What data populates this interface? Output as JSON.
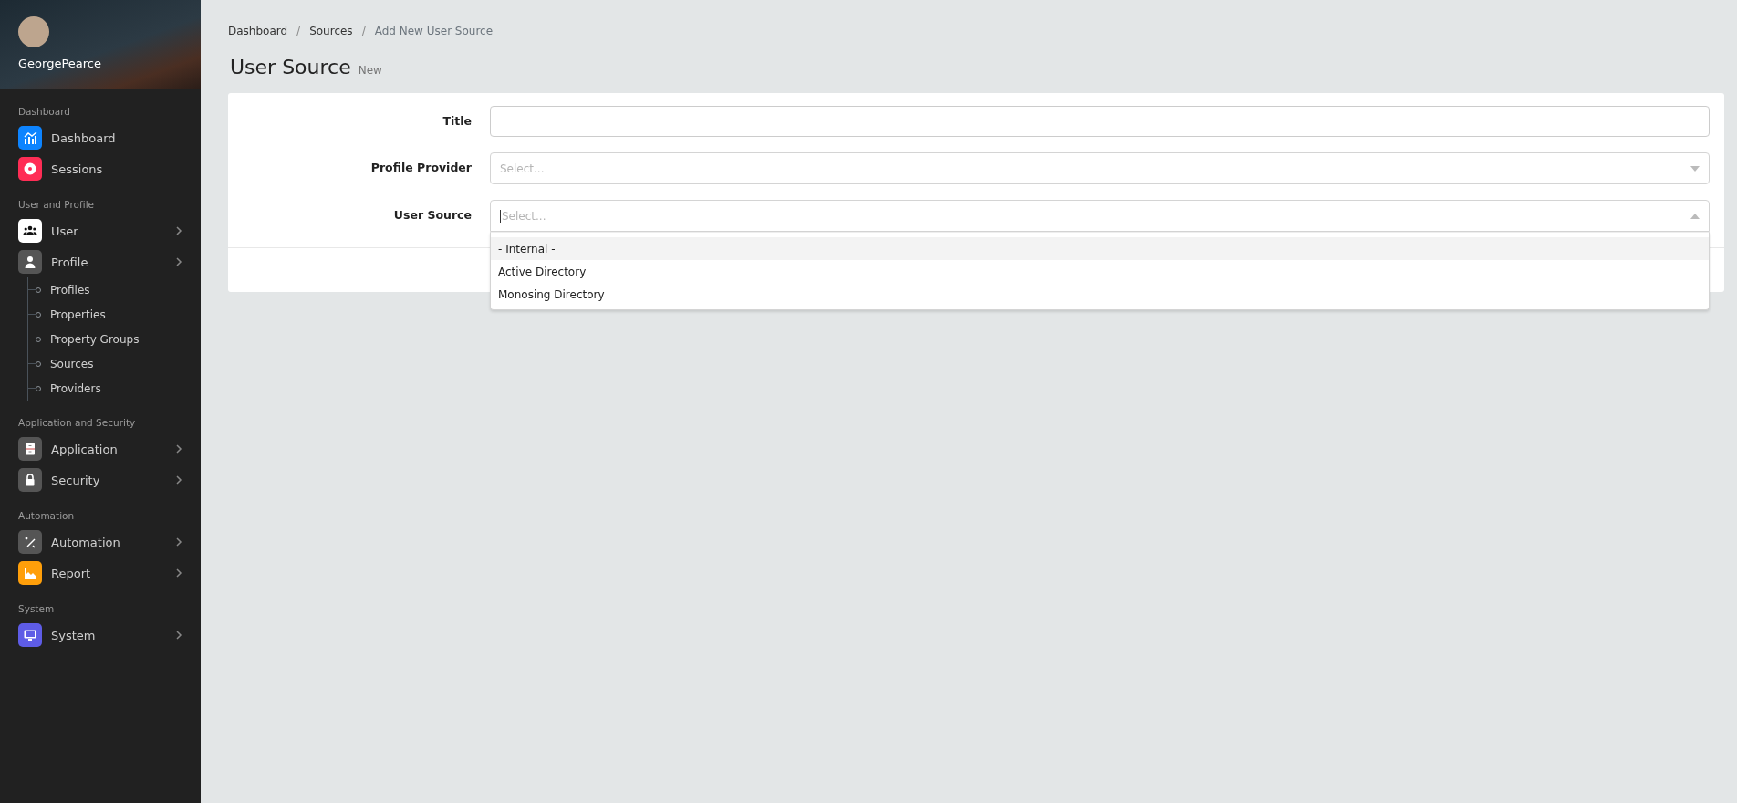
{
  "user": {
    "name": "GeorgePearce"
  },
  "sidebar": {
    "sections": [
      {
        "title": "Dashboard",
        "items": [
          {
            "label": "Dashboard",
            "color": "#0d84ff",
            "has_submenu": false
          },
          {
            "label": "Sessions",
            "color": "#ff2d55",
            "has_submenu": false
          }
        ]
      },
      {
        "title": "User and Profile",
        "items": [
          {
            "label": "User",
            "color": "#ffffff",
            "has_submenu": true
          },
          {
            "label": "Profile",
            "color": "#555555",
            "has_submenu": true,
            "children": [
              {
                "label": "Profiles"
              },
              {
                "label": "Properties"
              },
              {
                "label": "Property Groups"
              },
              {
                "label": "Sources"
              },
              {
                "label": "Providers"
              }
            ]
          }
        ]
      },
      {
        "title": "Application and Security",
        "items": [
          {
            "label": "Application",
            "color": "#555555",
            "has_submenu": true
          },
          {
            "label": "Security",
            "color": "#555555",
            "has_submenu": true
          }
        ]
      },
      {
        "title": "Automation",
        "items": [
          {
            "label": "Automation",
            "color": "#555555",
            "has_submenu": true
          },
          {
            "label": "Report",
            "color": "#ff9f0a",
            "has_submenu": true
          }
        ]
      },
      {
        "title": "System",
        "items": [
          {
            "label": "System",
            "color": "#5e5ce6",
            "has_submenu": true
          }
        ]
      }
    ]
  },
  "breadcrumb": [
    {
      "label": "Dashboard",
      "current": false
    },
    {
      "separator": "/",
      "label": "Sources",
      "current": false
    },
    {
      "separator": "/",
      "label": "Add New User Source",
      "current": true
    }
  ],
  "page": {
    "title": "User Source",
    "subtitle": "New"
  },
  "form": {
    "fields": [
      {
        "kind": "text",
        "label": "Title"
      },
      {
        "kind": "select",
        "label": "Profile Provider",
        "placeholder": "Select...",
        "open": false
      },
      {
        "kind": "select",
        "label": "User Source",
        "placeholder": "Select...",
        "open": true,
        "options": [
          {
            "label": "- Internal -",
            "highlighted": true
          },
          {
            "label": "Active Directory",
            "highlighted": false
          },
          {
            "label": "Monosing Directory",
            "highlighted": false
          }
        ]
      }
    ]
  }
}
